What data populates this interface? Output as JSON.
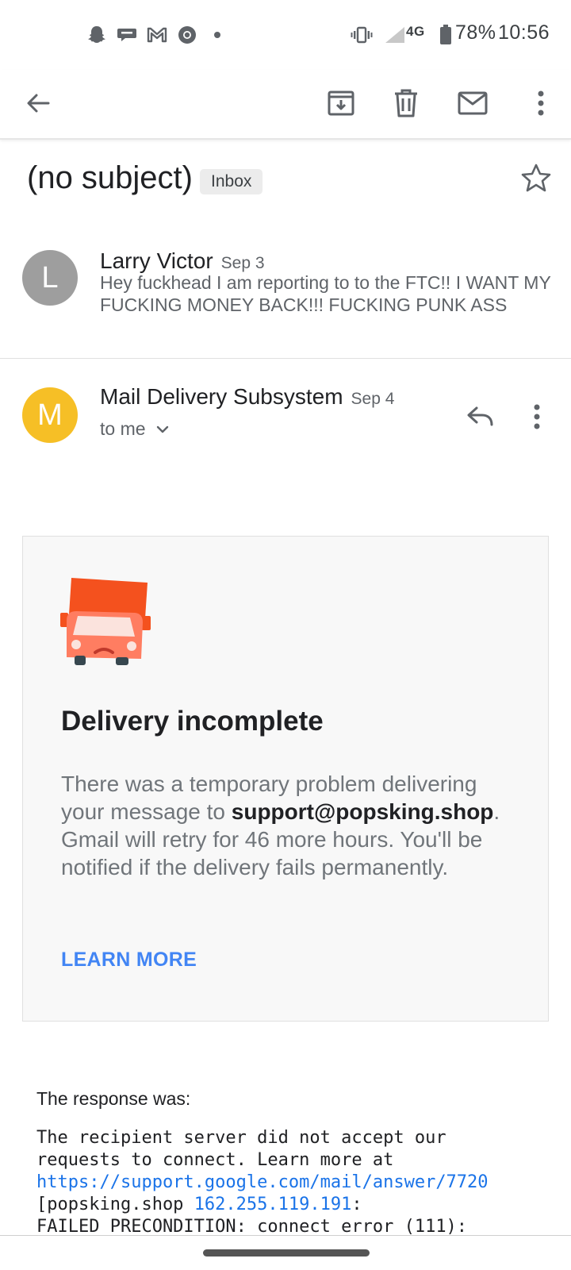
{
  "status_bar": {
    "notification_icons": [
      "snapchat-icon",
      "chat-icon",
      "gmail-icon",
      "chrome-icon",
      "dot-icon"
    ],
    "network_label": "4G",
    "battery": "78%",
    "time": "10:56"
  },
  "toolbar": {
    "icons": [
      "back-arrow-icon",
      "archive-icon",
      "delete-icon",
      "mark-unread-icon",
      "more-vert-icon"
    ]
  },
  "thread": {
    "subject": "(no subject)",
    "label": "Inbox"
  },
  "messages": [
    {
      "avatar_letter": "L",
      "avatar_color": "#9e9e9e",
      "sender": "Larry Victor",
      "date": "Sep 3",
      "snippet": "Hey fuckhead I am reporting to to the FTC!! I WANT MY FUCKING MONEY BACK!!! FUCKING PUNK ASS"
    },
    {
      "avatar_letter": "M",
      "avatar_color": "#f6bf26",
      "sender": "Mail Delivery Subsystem",
      "date": "Sep 4",
      "recipient": "to me"
    }
  ],
  "card": {
    "title": "Delivery incomplete",
    "body_part1": "There was a temporary problem delivering your message to ",
    "body_email": "support@popsking.shop",
    "body_part2": ". Gmail will retry for 46 more hours. You'll be notified if the delivery fails permanently.",
    "learn_more": "LEARN MORE"
  },
  "response": {
    "label": "The response was:",
    "line1": "The recipient server did not accept our",
    "line2": "requests to connect. Learn more at",
    "link": "https://support.google.com/mail/answer/7720",
    "line4_prefix": "[popsking.shop ",
    "ip": "162.255.119.191",
    "line4_suffix": ":",
    "line5": "FAILED_PRECONDITION: connect error (111):"
  },
  "colors": {
    "accent": "#4285f4",
    "link": "#1a73e8",
    "truck_orange": "#f4511e"
  }
}
